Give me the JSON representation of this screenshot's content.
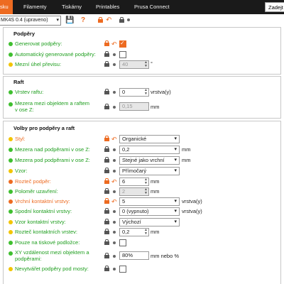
{
  "tabs": {
    "active": "sku",
    "items": [
      "Filamenty",
      "Tiskárny",
      "Printables",
      "Prusa Connect"
    ],
    "search": "Zadejt"
  },
  "toolbar": {
    "preset": "MK4S 0.4 (upraveno)"
  },
  "sections": {
    "supports": "Podpěry",
    "raft": "Raft",
    "options": "Volby pro podpěry a raft"
  },
  "fields": {
    "generate": "Generovat podpěry:",
    "auto": "Automatický generované podpěry:",
    "angle": "Mezní úhel převisu:",
    "angle_val": "40",
    "angle_unit": "°",
    "raft_layers": "Vrstev raftu:",
    "raft_layers_val": "0",
    "raft_layers_unit": "vrstva(y)",
    "raft_gap": "Mezera mezi objektem a raftem v ose Z:",
    "raft_gap_val": "0,15",
    "raft_gap_unit": "mm",
    "style": "Styl:",
    "style_val": "Organické",
    "top_z": "Mezera nad podpěrami v ose Z:",
    "top_z_val": "0,2",
    "top_z_unit": "mm",
    "bottom_z": "Mezera pod podpěrami v ose Z:",
    "bottom_z_val": "Stejné jako vrchní",
    "bottom_z_unit": "mm",
    "pattern": "Vzor:",
    "pattern_val": "Přímočarý",
    "spacing": "Rozteč podpěr:",
    "spacing_val": "6",
    "spacing_unit": "mm",
    "closing": "Poloměr uzavření:",
    "closing_val": "2",
    "closing_unit": "mm",
    "top_iface": "Vrchní kontaktní vrstvy:",
    "top_iface_val": "5",
    "top_iface_unit": "vrstva(y)",
    "bottom_iface": "Spodní kontaktní vrstvy:",
    "bottom_iface_val": "0 (vypnuto)",
    "bottom_iface_unit": "vrstva(y)",
    "iface_pattern": "Vzor kontaktní vrstvy:",
    "iface_pattern_val": "Výchozí",
    "iface_spacing": "Rozteč kontaktních vrstev:",
    "iface_spacing_val": "0,2",
    "iface_spacing_unit": "mm",
    "buildplate": "Pouze na tiskové podložce:",
    "xy_sep": "XY vzdálenost mezi objektem a podpěrami:",
    "xy_sep_val": "80%",
    "xy_sep_unit": "mm nebo %",
    "bridges": "Nevytvářet podpěry pod mosty:"
  },
  "colors": {
    "accent": "#ed6b21",
    "green": "#3fbf2f",
    "yellow": "#f2c400",
    "tabbar": "#1a1a1a"
  }
}
